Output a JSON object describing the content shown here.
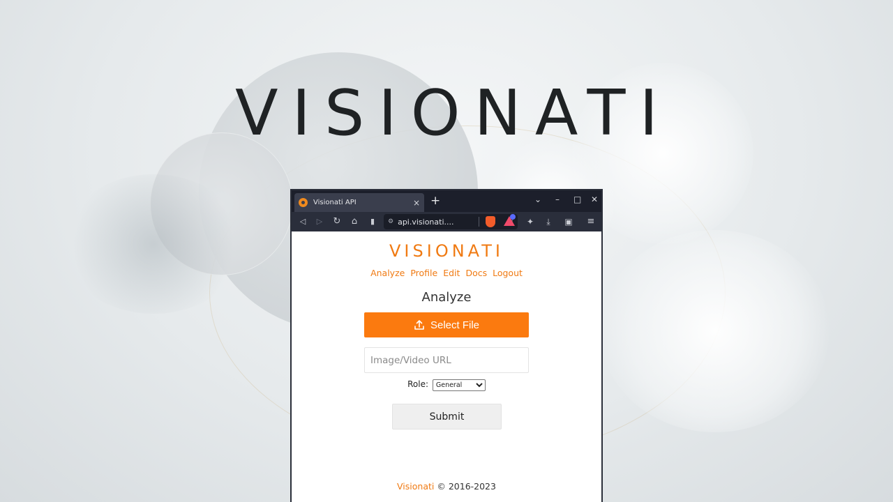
{
  "hero": {
    "title": "VISIONATI"
  },
  "browser": {
    "tab_title": "Visionati API",
    "tab_close": "×",
    "new_tab": "+",
    "url": "api.visionati....",
    "controls": {
      "list": "⌄",
      "minimize": "–",
      "maximize": "□",
      "close": "✕"
    },
    "icons": {
      "back": "◁",
      "forward": "▷",
      "reload": "↻",
      "home": "⌂",
      "bookmark": "▮",
      "site_info": "⚙",
      "share": "⋖",
      "extensions": "✦",
      "downloads": "⤓",
      "wallet": "▣",
      "menu": "≡"
    }
  },
  "app": {
    "brand": "VISIONATI",
    "nav": [
      "Analyze",
      "Profile",
      "Edit",
      "Docs",
      "Logout"
    ],
    "heading": "Analyze",
    "select_file_label": "Select File",
    "url_input_placeholder": "Image/Video URL",
    "role_label": "Role:",
    "role_selected": "General",
    "submit_label": "Submit",
    "footer_link": "Visionati",
    "footer_text": "© 2016-2023"
  },
  "colors": {
    "accent": "#f07a12",
    "button_orange": "#fb7a0f",
    "browser_dark": "#1c1f2b"
  }
}
